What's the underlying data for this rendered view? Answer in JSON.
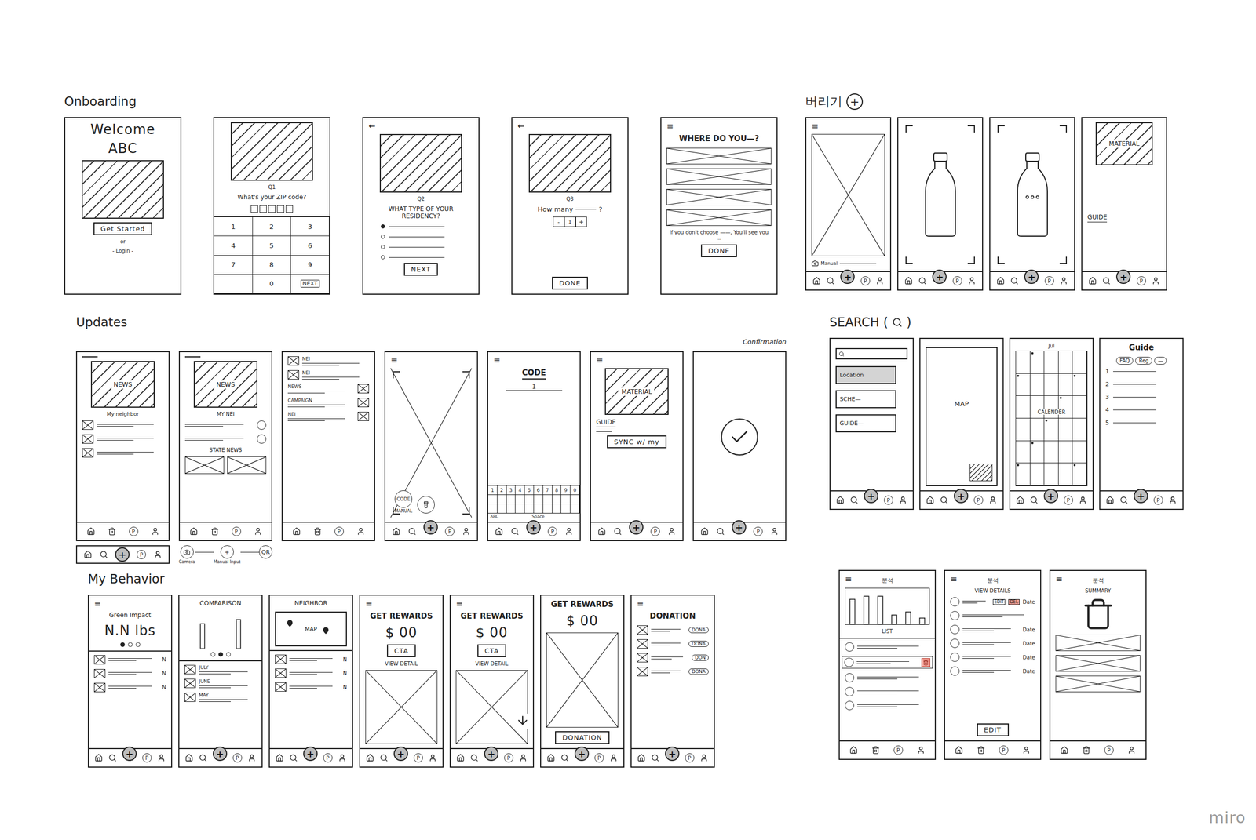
{
  "nav": {
    "plus": "+",
    "points": "P"
  },
  "watermark": "miro",
  "sections": [
    {
      "title": "Onboarding",
      "screens": [
        {
          "nav": "none",
          "blocks": [
            {
              "kind": "display",
              "text": "Welcome"
            },
            {
              "kind": "display",
              "text": "ABC"
            },
            {
              "kind": "image"
            },
            {
              "kind": "button",
              "text": "Get Started"
            },
            {
              "kind": "note",
              "text": "or"
            },
            {
              "kind": "note",
              "text": "- Login -"
            }
          ]
        },
        {
          "nav": "none",
          "blocks": [
            {
              "kind": "image"
            },
            {
              "kind": "note",
              "text": "Q1"
            },
            {
              "kind": "label",
              "text": "What's your ZIP code?"
            },
            {
              "kind": "digits",
              "count": 5
            },
            {
              "kind": "keypad",
              "keys": [
                "1",
                "2",
                "3",
                "4",
                "5",
                "6",
                "7",
                "8",
                "9",
                "",
                "0",
                "NEXT"
              ]
            }
          ]
        },
        {
          "nav": "none",
          "blocks": [
            {
              "kind": "back",
              "text": "←"
            },
            {
              "kind": "image"
            },
            {
              "kind": "note",
              "text": "Q2"
            },
            {
              "kind": "label",
              "text": "WHAT TYPE OF YOUR RESIDENCY?"
            },
            {
              "kind": "radios",
              "options": [
                {
                  "selected": true
                },
                {
                  "selected": false
                },
                {
                  "selected": false
                },
                {
                  "selected": false
                }
              ]
            },
            {
              "kind": "button",
              "text": "NEXT"
            }
          ]
        },
        {
          "nav": "none",
          "blocks": [
            {
              "kind": "back",
              "text": "←"
            },
            {
              "kind": "image"
            },
            {
              "kind": "note",
              "text": "Q3"
            },
            {
              "kind": "blankq",
              "text": "How many",
              "end": "?"
            },
            {
              "kind": "stepper",
              "items": [
                "-",
                "1",
                "+"
              ]
            },
            {
              "kind": "gap"
            },
            {
              "kind": "button",
              "text": "DONE"
            }
          ]
        },
        {
          "nav": "none",
          "blocks": [
            {
              "kind": "menu",
              "text": "≡"
            },
            {
              "kind": "heading",
              "text": "WHERE DO YOU—?",
              "underline": false
            },
            {
              "kind": "xlist",
              "count": 4
            },
            {
              "kind": "note",
              "text": "If you don't choose ——, You'll see you ..."
            },
            {
              "kind": "button",
              "text": "DONE"
            }
          ]
        }
      ]
    },
    {
      "title": "버리기",
      "badge": "+",
      "screens": [
        {
          "nav": "main",
          "blocks": [
            {
              "kind": "menu",
              "text": "≡"
            },
            {
              "kind": "xbox",
              "arrow": false
            },
            {
              "kind": "camera",
              "text": "Manual"
            }
          ]
        },
        {
          "nav": "main",
          "blocks": [
            {
              "kind": "bottle",
              "dots": false
            }
          ]
        },
        {
          "nav": "main",
          "blocks": [
            {
              "kind": "bottle",
              "dots": true
            }
          ]
        },
        {
          "nav": "main",
          "blocks": [
            {
              "kind": "image",
              "text": "MATERIAL"
            },
            {
              "kind": "gap"
            },
            {
              "kind": "label",
              "text": "GUIDE",
              "underline": true
            },
            {
              "kind": "gap"
            }
          ]
        }
      ]
    },
    {
      "title": "Updates",
      "screens": [
        {
          "nav": "bin",
          "below": {
            "kind": "navstrip"
          },
          "blocks": [
            {
              "kind": "rule"
            },
            {
              "kind": "image",
              "text": "NEWS"
            },
            {
              "kind": "note",
              "text": "My neighbor"
            },
            {
              "kind": "rows",
              "items": [
                {
                  "thumb": "xbox"
                },
                {
                  "thumb": "xbox"
                },
                {
                  "thumb": "xbox"
                }
              ]
            }
          ]
        },
        {
          "nav": "bin",
          "below": {
            "kind": "actions",
            "camera": "Camera",
            "plus": "+",
            "manual": "Manual Input",
            "qr": "QR"
          },
          "blocks": [
            {
              "kind": "rule"
            },
            {
              "kind": "image",
              "text": "NEWS"
            },
            {
              "kind": "note",
              "text": "MY NEI"
            },
            {
              "kind": "rows",
              "items": [
                {
                  "thumb": "circle",
                  "side": "right"
                },
                {
                  "thumb": "circle",
                  "side": "right"
                }
              ]
            },
            {
              "kind": "note",
              "text": "STATE NEWS"
            },
            {
              "kind": "xpair",
              "count": 2
            }
          ]
        },
        {
          "nav": "bin",
          "blocks": [
            {
              "kind": "rows",
              "items": [
                {
                  "thumb": "xbox",
                  "label": "NEI"
                },
                {
                  "thumb": "xbox",
                  "label": "NEI"
                },
                {
                  "thumb": "xbox",
                  "label": "NEWS",
                  "side": "right"
                },
                {
                  "thumb": "xbox",
                  "label": "CAMPAIGN",
                  "side": "right"
                },
                {
                  "thumb": "xbox",
                  "label": "NEI",
                  "side": "right"
                }
              ]
            }
          ]
        },
        {
          "nav": "main",
          "blocks": [
            {
              "kind": "menu",
              "text": "≡"
            },
            {
              "kind": "scanner",
              "code": "CODE",
              "manual": "MANUAL"
            }
          ]
        },
        {
          "nav": "main",
          "blocks": [
            {
              "kind": "menu",
              "text": "≡"
            },
            {
              "kind": "heading",
              "text": "CODE",
              "underline": true
            },
            {
              "kind": "field",
              "text": "1"
            },
            {
              "kind": "gap"
            },
            {
              "kind": "keyboard",
              "keys": [
                "1",
                "2",
                "3",
                "4",
                "5",
                "6",
                "7",
                "8",
                "9",
                "0"
              ],
              "abc": "ABC",
              "space": "Space"
            }
          ]
        },
        {
          "nav": "main",
          "blocks": [
            {
              "kind": "menu",
              "text": "≡"
            },
            {
              "kind": "image",
              "text": "MATERIAL"
            },
            {
              "kind": "label",
              "text": "GUIDE",
              "underline": true
            },
            {
              "kind": "rule"
            },
            {
              "kind": "button",
              "text": "SYNC w/ my"
            }
          ]
        },
        {
          "nav": "main",
          "caption": "Confirmation",
          "blocks": [
            {
              "kind": "check"
            }
          ]
        }
      ]
    },
    {
      "title": "SEARCH (",
      "title_end": ")",
      "screens": [
        {
          "nav": "main",
          "blocks": [
            {
              "kind": "search"
            },
            {
              "kind": "options",
              "items": [
                {
                  "label": "Location",
                  "highlighted": true
                },
                {
                  "label": "SCHE—",
                  "highlighted": false
                },
                {
                  "label": "GUIDE—",
                  "highlighted": false
                }
              ]
            }
          ]
        },
        {
          "nav": "main",
          "blocks": [
            {
              "kind": "mapfull",
              "text": "MAP"
            }
          ]
        },
        {
          "nav": "main",
          "blocks": [
            {
              "kind": "calendar",
              "month": "Jul",
              "text": "CALENDER"
            }
          ]
        },
        {
          "nav": "main",
          "blocks": [
            {
              "kind": "heading",
              "text": "Guide",
              "underline": false
            },
            {
              "kind": "tabs",
              "items": [
                "FAQ",
                "Reg",
                "—"
              ]
            },
            {
              "kind": "numbered",
              "items": [
                "1",
                "2",
                "3",
                "4",
                "5"
              ]
            }
          ]
        }
      ]
    },
    {
      "title": "My Behavior",
      "screens": [
        {
          "nav": "main",
          "blocks": [
            {
              "kind": "menu",
              "text": "≡"
            },
            {
              "kind": "label",
              "text": "Green Impact"
            },
            {
              "kind": "display",
              "text": "N.N lbs"
            },
            {
              "kind": "dots",
              "items": [
                true,
                false,
                false
              ]
            },
            {
              "kind": "divider"
            },
            {
              "kind": "rows",
              "items": [
                {
                  "thumb": "xbox",
                  "trail": "N"
                },
                {
                  "thumb": "xbox",
                  "trail": "N"
                },
                {
                  "thumb": "xbox",
                  "trail": "N"
                }
              ]
            }
          ]
        },
        {
          "nav": "main",
          "blocks": [
            {
              "kind": "label",
              "text": "COMPARISON"
            },
            {
              "kind": "bars",
              "values": [
                3,
                3.5
              ],
              "framed": false
            },
            {
              "kind": "dots",
              "items": [
                false,
                true,
                false
              ]
            },
            {
              "kind": "divider"
            },
            {
              "kind": "rows",
              "items": [
                {
                  "thumb": "xbox",
                  "label": "JULY"
                },
                {
                  "thumb": "xbox",
                  "label": "JUNE"
                },
                {
                  "thumb": "xbox",
                  "label": "MAY"
                }
              ]
            }
          ]
        },
        {
          "nav": "main",
          "blocks": [
            {
              "kind": "label",
              "text": "NEIGHBOR"
            },
            {
              "kind": "minimap",
              "text": "MAP",
              "pins": 2
            },
            {
              "kind": "divider"
            },
            {
              "kind": "rows",
              "items": [
                {
                  "thumb": "xbox",
                  "trail": "N"
                },
                {
                  "thumb": "xbox",
                  "trail": "N"
                },
                {
                  "thumb": "xbox",
                  "trail": "N"
                }
              ]
            }
          ]
        },
        {
          "nav": "main",
          "blocks": [
            {
              "kind": "menu",
              "text": "≡"
            },
            {
              "kind": "heading",
              "text": "GET REWARDS",
              "underline": false
            },
            {
              "kind": "display",
              "text": "$ 00"
            },
            {
              "kind": "button",
              "text": "CTA"
            },
            {
              "kind": "note",
              "text": "VIEW DETAIL"
            },
            {
              "kind": "xbox",
              "arrow": false
            }
          ]
        },
        {
          "nav": "main",
          "blocks": [
            {
              "kind": "menu",
              "text": "≡"
            },
            {
              "kind": "heading",
              "text": "GET REWARDS",
              "underline": false
            },
            {
              "kind": "display",
              "text": "$ 00"
            },
            {
              "kind": "button",
              "text": "CTA"
            },
            {
              "kind": "note",
              "text": "VIEW DETAIL"
            },
            {
              "kind": "xbox",
              "arrow": true
            }
          ]
        },
        {
          "nav": "main",
          "blocks": [
            {
              "kind": "heading",
              "text": "GET REWARDS",
              "underline": false
            },
            {
              "kind": "display",
              "text": "$ 00"
            },
            {
              "kind": "xbox",
              "arrow": false
            },
            {
              "kind": "button",
              "text": "DONATION"
            }
          ]
        },
        {
          "nav": "main",
          "blocks": [
            {
              "kind": "menu",
              "text": "≡"
            },
            {
              "kind": "heading",
              "text": "DONATION",
              "underline": false
            },
            {
              "kind": "rows",
              "items": [
                {
                  "thumb": "xbox",
                  "trail": "DONA",
                  "pill": true
                },
                {
                  "thumb": "xbox",
                  "trail": "DONA",
                  "pill": true
                },
                {
                  "thumb": "xbox",
                  "trail": "DON",
                  "pill": true
                },
                {
                  "thumb": "xbox",
                  "trail": "DONA",
                  "pill": true
                }
              ]
            }
          ]
        }
      ]
    },
    {
      "screens": [
        {
          "nav": "bin",
          "blocks": [
            {
              "kind": "menu",
              "text": "≡"
            },
            {
              "kind": "title",
              "text": "분석"
            },
            {
              "kind": "bars",
              "values": [
                8,
                9,
                9,
                3,
                4,
                2
              ],
              "framed": true
            },
            {
              "kind": "note",
              "text": "LIST"
            },
            {
              "kind": "divider"
            },
            {
              "kind": "rows",
              "items": [
                {
                  "thumb": "circle",
                  "selected": false
                },
                {
                  "thumb": "circle",
                  "selected": true
                },
                {
                  "thumb": "circle",
                  "selected": false
                },
                {
                  "thumb": "circle",
                  "selected": false
                },
                {
                  "thumb": "circle",
                  "selected": false
                }
              ]
            }
          ]
        },
        {
          "nav": "bin",
          "blocks": [
            {
              "kind": "menu",
              "text": "≡"
            },
            {
              "kind": "title",
              "text": "분석"
            },
            {
              "kind": "note",
              "text": "VIEW DETAILS"
            },
            {
              "kind": "rows",
              "items": [
                {
                  "thumb": "circle",
                  "trail": "Date",
                  "badges": [
                    {
                      "text": "EDIT",
                      "color": "#ffffff"
                    },
                    {
                      "text": "DEL",
                      "color": "#f2a197"
                    }
                  ]
                },
                {
                  "thumb": "circle"
                },
                {
                  "thumb": "circle",
                  "trail": "Date"
                },
                {
                  "thumb": "circle",
                  "trail": "Date"
                },
                {
                  "thumb": "circle",
                  "trail": "Date"
                },
                {
                  "thumb": "circle",
                  "trail": "Date"
                }
              ]
            },
            {
              "kind": "gap"
            },
            {
              "kind": "button",
              "text": "EDIT"
            }
          ]
        },
        {
          "nav": "bin",
          "blocks": [
            {
              "kind": "menu",
              "text": "≡"
            },
            {
              "kind": "title",
              "text": "분석"
            },
            {
              "kind": "note",
              "text": "SUMMARY"
            },
            {
              "kind": "bin"
            },
            {
              "kind": "xlist",
              "count": 3
            }
          ]
        }
      ]
    }
  ]
}
